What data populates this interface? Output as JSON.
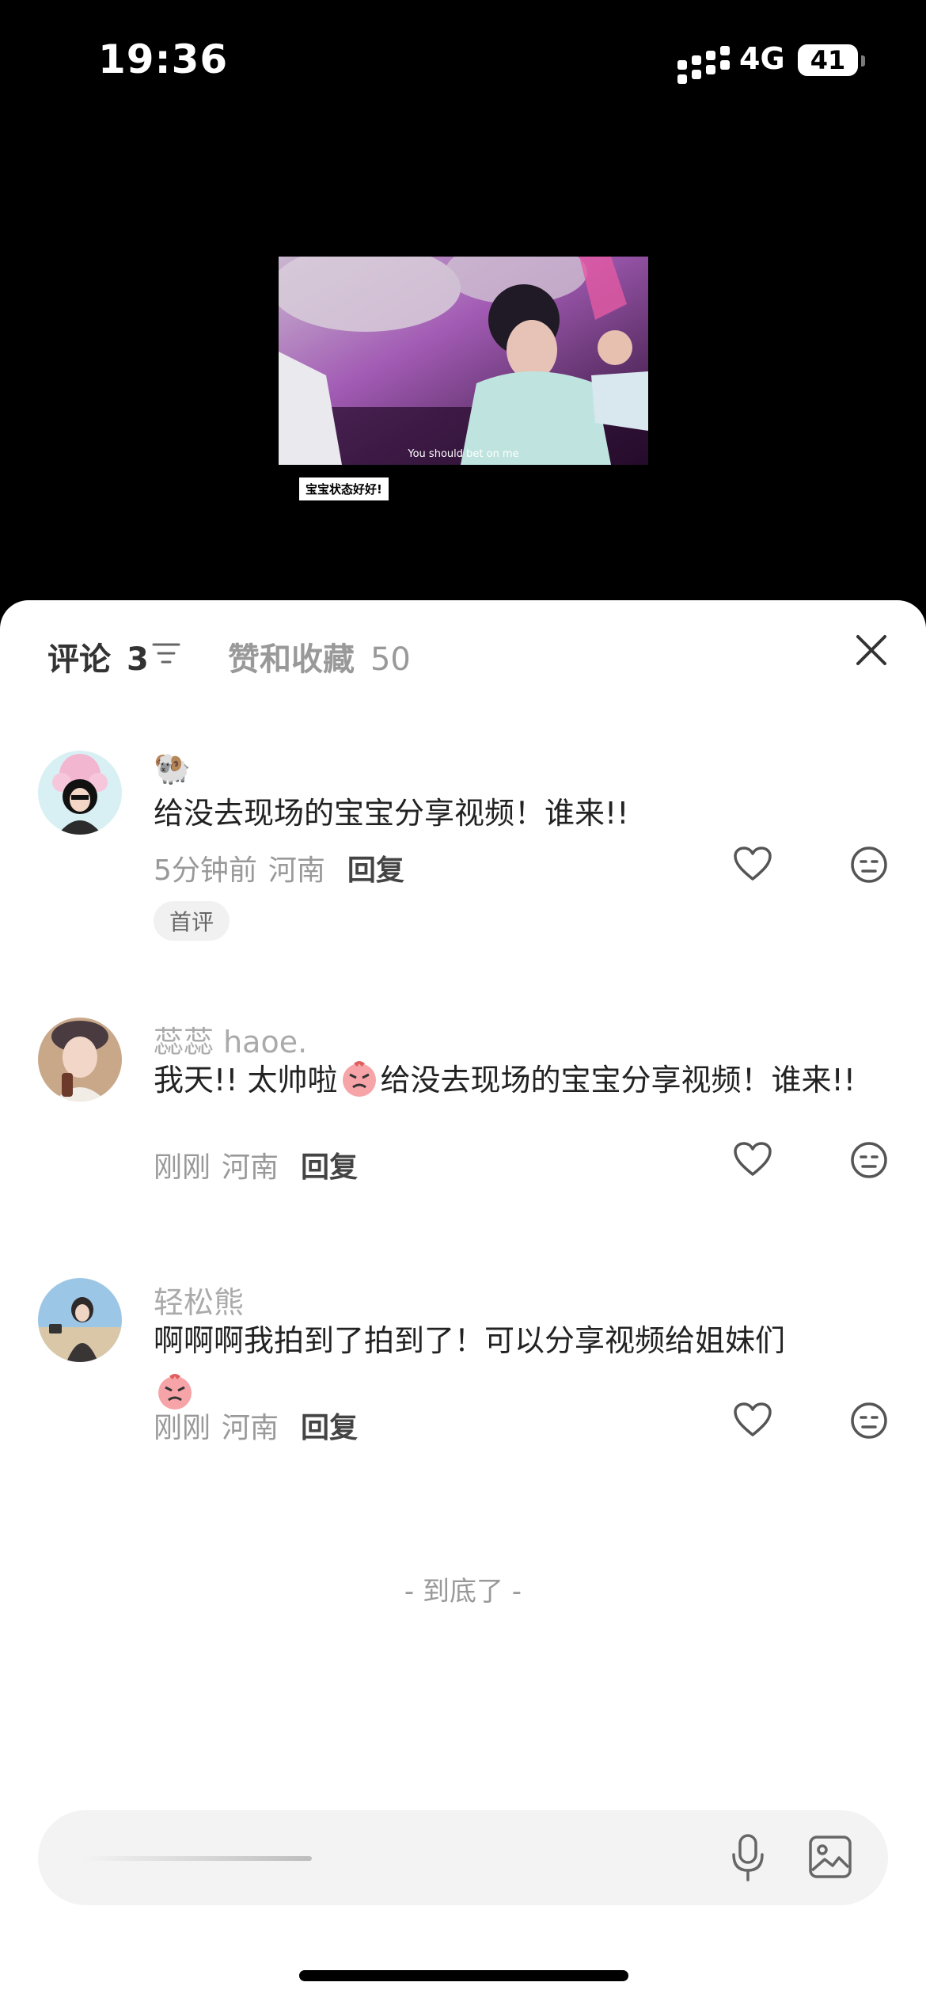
{
  "status": {
    "time": "19:36",
    "network": "4G",
    "battery": "41"
  },
  "video": {
    "subtitle": "You should bet on me",
    "caption": "宝宝状态好好!"
  },
  "tabs": {
    "comments_label": "评论",
    "comments_count": "3",
    "likes_label": "赞和收藏",
    "likes_count": "50"
  },
  "comments": [
    {
      "username": "🐏",
      "text": "给没去现场的宝宝分享视频！谁来!!",
      "time": "5分钟前",
      "location": "河南",
      "reply": "回复",
      "badge": "首评"
    },
    {
      "username": "蕊蕊 haoe.",
      "text_before": "我天!! 太帅啦",
      "text_after": "给没去现场的宝宝分享视频！谁来!!",
      "time": "刚刚",
      "location": "河南",
      "reply": "回复"
    },
    {
      "username": "轻松熊",
      "text": "啊啊啊我拍到了拍到了！可以分享视频给姐妹们",
      "time": "刚刚",
      "location": "河南",
      "reply": "回复"
    }
  ],
  "end_marker": "- 到底了 -",
  "icons": {
    "sort": "sort-icon",
    "close": "close-icon",
    "like": "heart-icon",
    "dislike": "meh-face-icon",
    "mic": "mic-icon",
    "image": "image-icon"
  }
}
